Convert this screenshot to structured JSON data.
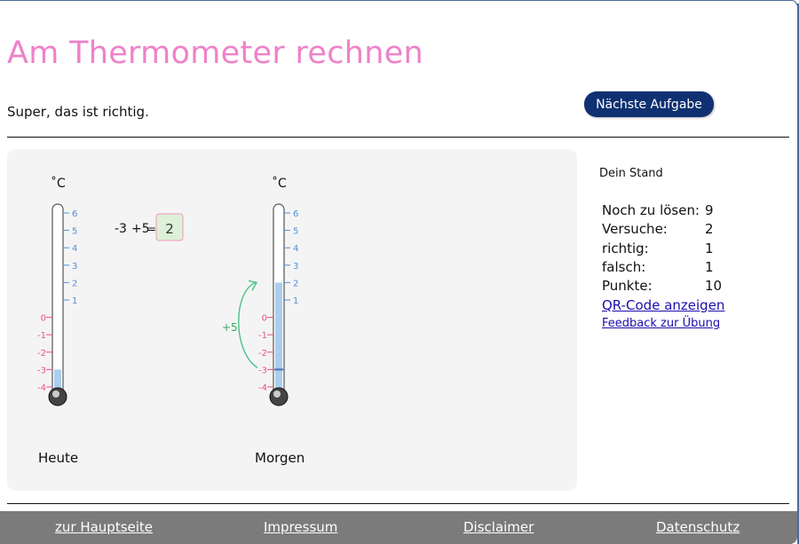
{
  "page": {
    "title": "Am Thermometer rechnen",
    "feedback": "Super, das ist richtig.",
    "next_button": "Nächste Aufgabe"
  },
  "task": {
    "start": "-3",
    "change": "+5",
    "equals": "=",
    "answer": "2",
    "arrow_label": "+5"
  },
  "thermometers": [
    {
      "label": "Heute",
      "unit": "˚C",
      "value": -3,
      "ticks": [
        "6",
        "5",
        "4",
        "3",
        "2",
        "1",
        "0",
        "-1",
        "-2",
        "-3",
        "-4"
      ]
    },
    {
      "label": "Morgen",
      "unit": "˚C",
      "value": 2,
      "ticks": [
        "6",
        "5",
        "4",
        "3",
        "2",
        "1",
        "0",
        "-1",
        "-2",
        "-3",
        "-4"
      ]
    }
  ],
  "stand": {
    "title": "Dein Stand",
    "rows": [
      {
        "label": "Noch zu lösen:",
        "value": "9"
      },
      {
        "label": "Versuche:",
        "value": "2"
      },
      {
        "label": "richtig:",
        "value": "1"
      },
      {
        "label": "falsch:",
        "value": "1"
      },
      {
        "label": "Punkte:",
        "value": "10"
      }
    ],
    "qr_link": "QR-Code anzeigen",
    "feedback_link": "Feedback zur Übung"
  },
  "footer": {
    "links": [
      "zur Hauptseite",
      "Impressum",
      "Disclaimer",
      "Datenschutz"
    ]
  },
  "colors": {
    "title": "#ee82c9",
    "button": "#0f3171",
    "positive_scale": "#4f8fd6",
    "negative_scale": "#e8508a",
    "mercury": "#aacdf0",
    "arrow": "#4cbf86",
    "answer_box_bg": "#ddf0d8",
    "answer_box_border": "#f09ab6",
    "footer": "#7b7b7b"
  }
}
